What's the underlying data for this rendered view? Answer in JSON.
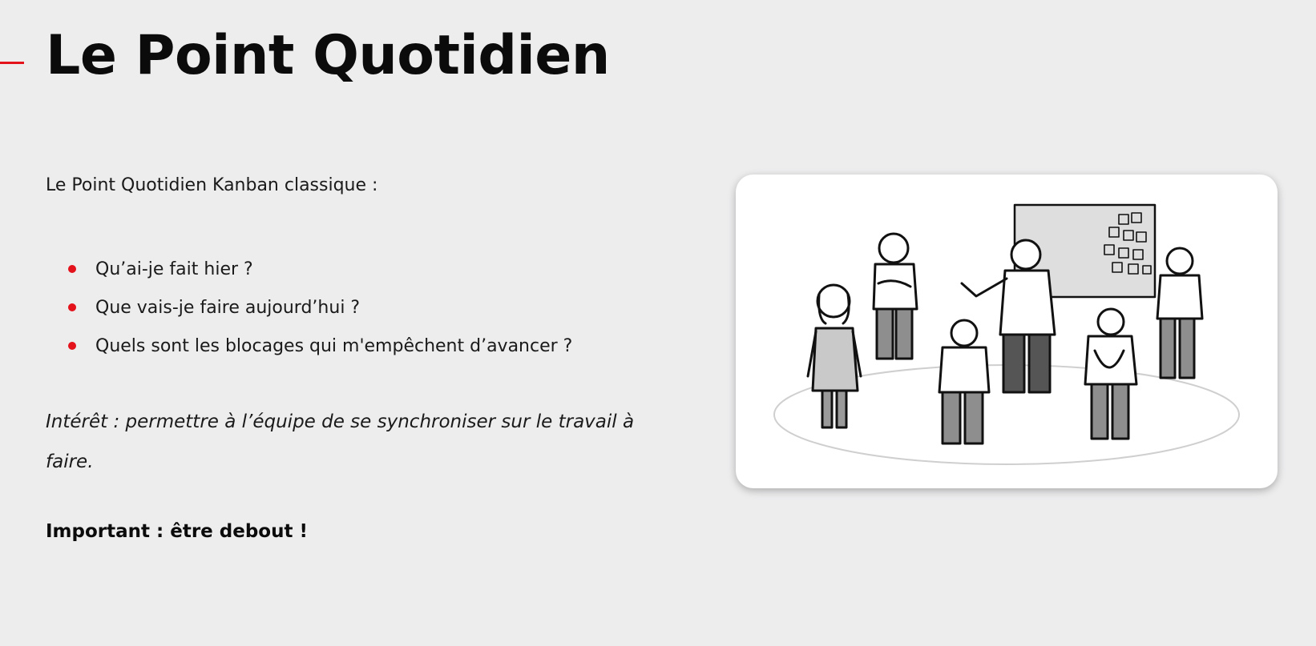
{
  "slide": {
    "title": "Le Point Quotidien",
    "intro": "Le Point Quotidien Kanban classique :",
    "bullets": [
      "Qu’ai-je fait hier ?",
      "Que vais-je faire aujourd’hui ?",
      "Quels sont les blocages qui m'empêchent d’avancer ?"
    ],
    "interet": "Intérêt : permettre à l’équipe de se synchroniser sur le travail à faire.",
    "important": "Important : être debout !"
  },
  "colors": {
    "accent": "#e3121b",
    "background": "#ededee",
    "text": "#111111"
  },
  "illustration": {
    "icon": "standup-meeting-sketch"
  }
}
